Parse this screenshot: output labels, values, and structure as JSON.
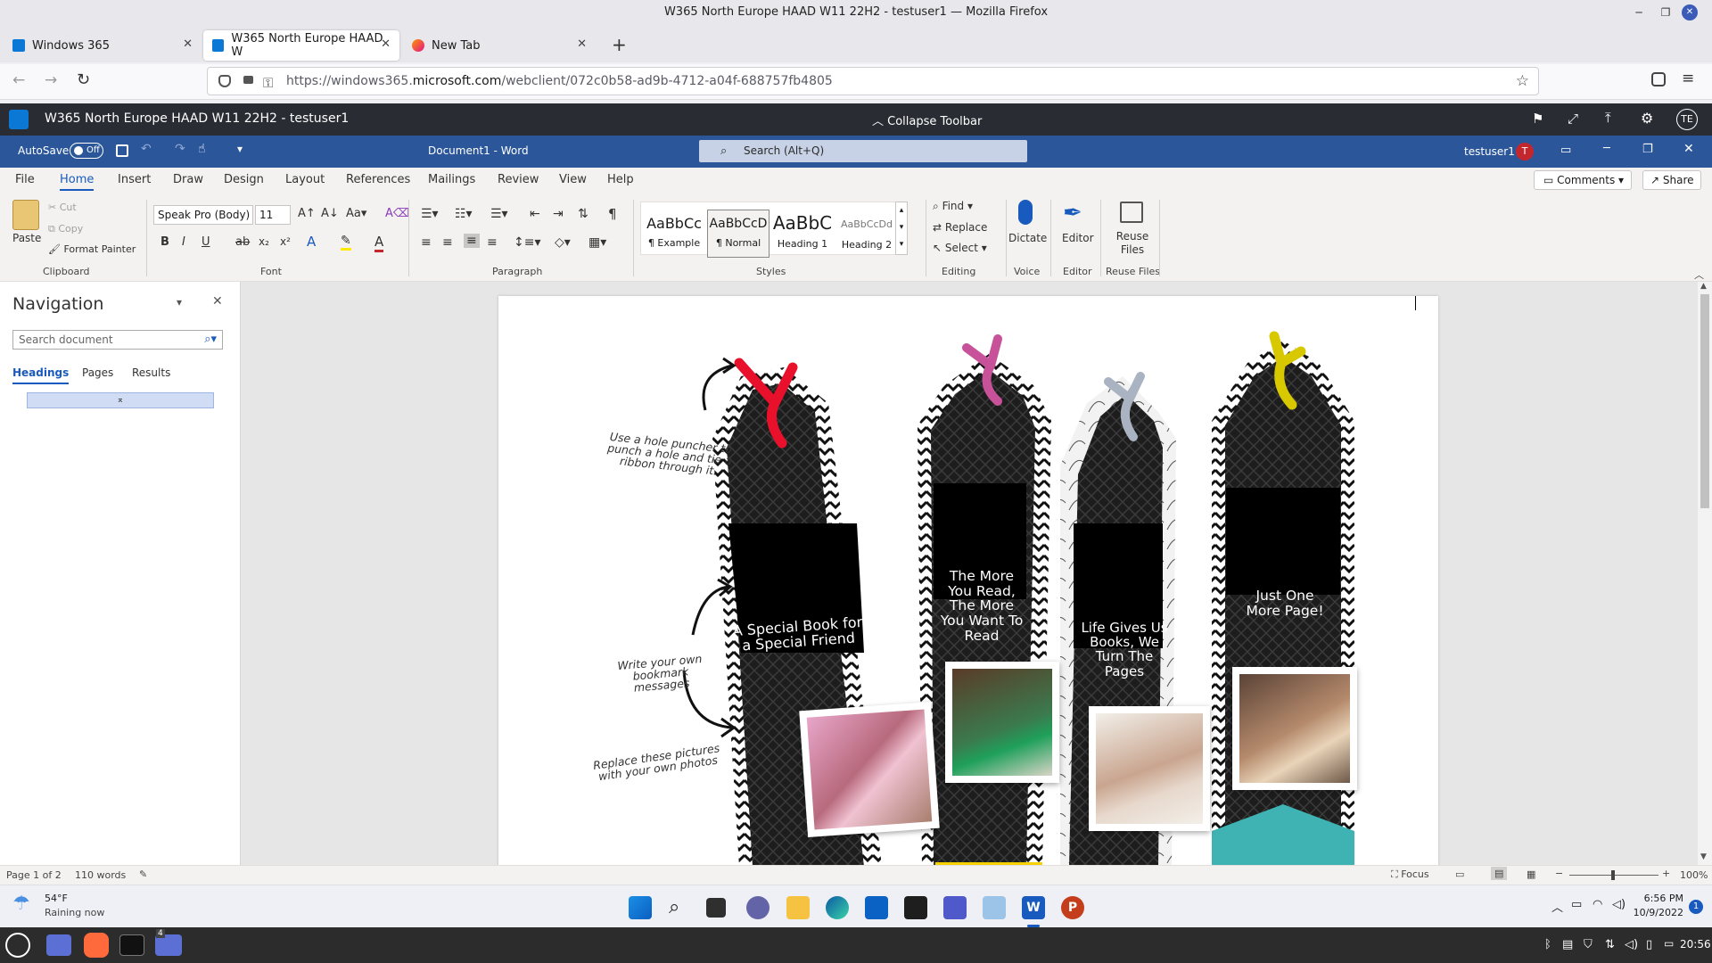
{
  "browser": {
    "window_title": "W365 North Europe HAAD W11 22H2 - testuser1 — Mozilla Firefox",
    "tabs": [
      {
        "label": "Windows 365"
      },
      {
        "label": "W365 North Europe HAAD W"
      },
      {
        "label": "New Tab"
      }
    ],
    "url_plain": "https://windows365.",
    "url_domain": "microsoft.com",
    "url_path": "/webclient/072c0b58-ad9b-4712-a04f-688757fb4805"
  },
  "w365": {
    "session_title": "W365 North Europe HAAD W11 22H2 - testuser1",
    "collapse_label": "Collapse Toolbar",
    "avatar": "TE"
  },
  "word": {
    "autosave_label": "AutoSave",
    "autosave_state": "Off",
    "doc_title": "Document1 - Word",
    "search_placeholder": "Search (Alt+Q)",
    "user": "testuser1",
    "user_initial": "T",
    "menu": [
      "File",
      "Home",
      "Insert",
      "Draw",
      "Design",
      "Layout",
      "References",
      "Mailings",
      "Review",
      "View",
      "Help"
    ],
    "comments_label": "Comments",
    "share_label": "Share",
    "ribbon": {
      "paste": "Paste",
      "cut": "Cut",
      "copy": "Copy",
      "format_painter": "Format Painter",
      "clipboard": "Clipboard",
      "font_name": "Speak Pro (Body)",
      "font_size": "11",
      "font": "Font",
      "paragraph": "Paragraph",
      "styles": [
        {
          "preview": "AaBbCc",
          "name": "¶ Example"
        },
        {
          "preview": "AaBbCcD",
          "name": "¶ Normal"
        },
        {
          "preview": "AaBbC",
          "name": "Heading 1"
        },
        {
          "preview": "AaBbCcDd",
          "name": "Heading 2"
        }
      ],
      "styles_label": "Styles",
      "find": "Find",
      "replace": "Replace",
      "select": "Select",
      "editing": "Editing",
      "dictate": "Dictate",
      "voice": "Voice",
      "editor": "Editor",
      "editor_group": "Editor",
      "reuse_files": "Reuse Files",
      "reuse_group": "Reuse Files"
    },
    "navigation": {
      "title": "Navigation",
      "search_placeholder": "Search document",
      "tabs": [
        "Headings",
        "Pages",
        "Results"
      ]
    },
    "status": {
      "page": "Page 1 of 2",
      "words": "110 words",
      "focus": "Focus",
      "zoom": "100%"
    }
  },
  "document": {
    "notes": [
      "Use a hole puncher to punch a hole and tie a ribbon through it.",
      "Write your own bookmark messages",
      "Replace these pictures with your own photos"
    ],
    "bookmarks": [
      {
        "text": "A Special Book for a Special Friend",
        "ribbon_color": "#e8102a"
      },
      {
        "text": "The More You Read, The More You Want To Read",
        "ribbon_color": "#c8529a"
      },
      {
        "text": "Life Gives Us Books, We Turn The Pages",
        "ribbon_color": "#a9b3c2"
      },
      {
        "text": "Just One More Page!",
        "ribbon_color": "#d7c800"
      }
    ]
  },
  "taskbar": {
    "weather_temp": "54°F",
    "weather_desc": "Raining now",
    "time": "6:56 PM",
    "date": "10/9/2022",
    "notif": "1"
  },
  "panel": {
    "clock": "20:56",
    "badge": "4"
  }
}
